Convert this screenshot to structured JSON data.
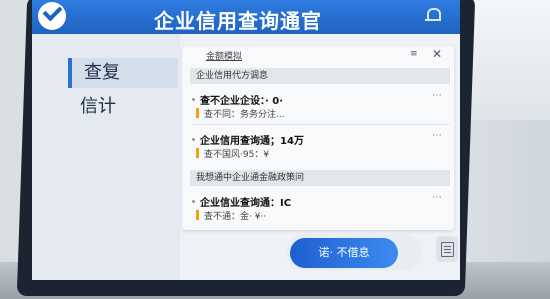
{
  "app": {
    "title": "企业信用查询通官"
  },
  "sidebar": {
    "items": [
      {
        "label": "查复"
      },
      {
        "label": "信计"
      }
    ]
  },
  "panel": {
    "title": "金额模拟",
    "option_label": "≡",
    "close_label": "✕",
    "sections": [
      {
        "label": "企业信用代方调息"
      },
      {
        "label": "我想通中企业通金融政策问"
      }
    ],
    "cards": [
      {
        "title": "查不企业企设：· 0·",
        "sub": "查不同：务务分注..."
      },
      {
        "title": "企业信用查询通；14万",
        "sub": "查不国风·95：¥"
      },
      {
        "title": "企业信业查询通：IC",
        "sub": "查不通：金· ¥··"
      }
    ]
  },
  "composer": {
    "send_label": "诺· 不借息",
    "attach_icon": "document-icon"
  },
  "colors": {
    "brand": "#1f63c2",
    "accent": "#f0a11a"
  }
}
